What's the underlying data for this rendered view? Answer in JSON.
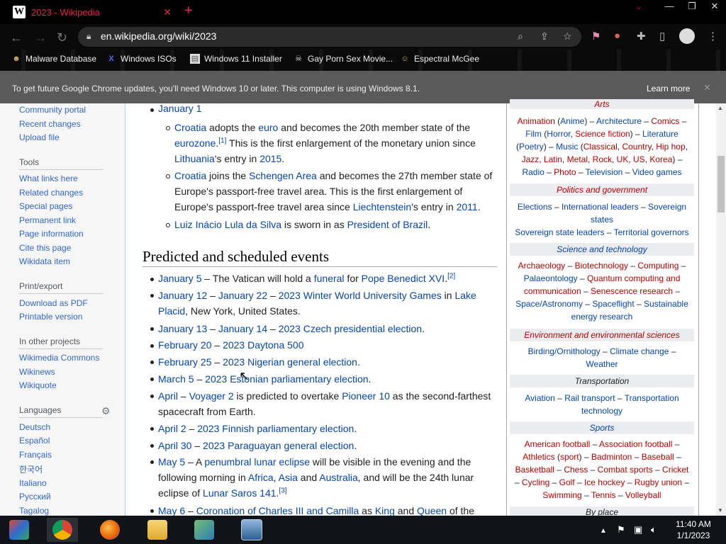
{
  "browser": {
    "tab_title": "2023 - Wikipedia",
    "tab_favicon": "W",
    "tab_close": "✕",
    "new_tab": "+",
    "url": "en.wikipedia.org/wiki/2023",
    "window_controls": {
      "minimize": "—",
      "maximize": "❐",
      "close": "✕"
    },
    "tab_search_icon": "chevron-down-icon"
  },
  "bookmarks": [
    {
      "label": "Malware Database",
      "icon": "person-icon"
    },
    {
      "label": "Windows ISOs",
      "icon": "x-icon"
    },
    {
      "label": "Windows 11 Installer",
      "icon": "doc-icon"
    },
    {
      "label": "Gay Porn Sex Movie...",
      "icon": "skull-icon"
    },
    {
      "label": "Espectral McGee",
      "icon": "face-icon"
    }
  ],
  "infobar": {
    "message": "To get future Google Chrome updates, you'll need Windows 10 or later. This computer is using Windows 8.1.",
    "learn_more": "Learn more",
    "close": "✕"
  },
  "sidebar": {
    "links_top": [
      "Community portal",
      "Recent changes",
      "Upload file"
    ],
    "tools_heading": "Tools",
    "tools": [
      "What links here",
      "Related changes",
      "Special pages",
      "Permanent link",
      "Page information",
      "Cite this page",
      "Wikidata item"
    ],
    "print_heading": "Print/export",
    "print": [
      "Download as PDF",
      "Printable version"
    ],
    "projects_heading": "In other projects",
    "projects": [
      "Wikimedia Commons",
      "Wikinews",
      "Wikiquote"
    ],
    "languages_heading": "Languages",
    "languages": [
      "Deutsch",
      "Español",
      "Français",
      "한국어",
      "Italiano",
      "Русский",
      "Tagalog"
    ]
  },
  "article": {
    "jan1": "January 1",
    "b1": {
      "a1": "Croatia",
      "t1": " adopts the ",
      "a2": "euro",
      "t2": " and becomes the 20th member state of the",
      "a3": "eurozone",
      "t3": ".",
      "ref": "[1]",
      "t4": " This is the first enlargement of the monetary union since",
      "a4": "Lithuania",
      "t5": "'s entry in ",
      "a5": "2015",
      "t6": "."
    },
    "b2": {
      "a1": "Croatia",
      "t1": " joins the ",
      "a2": "Schengen Area",
      "t2": " and becomes the 27th member state of",
      "l2": "Europe's passport-free travel area. This is the first enlargement of",
      "l3a": "Europe's passport-free travel area since ",
      "a3": "Liechtenstein",
      "t3": "'s entry in ",
      "a4": "2011",
      "t4": "."
    },
    "b3": {
      "a1": "Luiz Inácio Lula da Silva",
      "t1": " is sworn in as ",
      "a2": "President of Brazil",
      "t2": "."
    },
    "heading": "Predicted and scheduled events",
    "events": {
      "e1": {
        "a1": "January 5",
        "t1": " – The Vatican will hold a ",
        "a2": "funeral",
        "t2": " for ",
        "a3": "Pope Benedict XVI",
        "t3": ".",
        "ref": "[2]"
      },
      "e2": {
        "a1": "January 12",
        "t1": " – ",
        "a2": "January 22",
        "t2": " – ",
        "a3": "2023 Winter World University Games",
        "t3": " in ",
        "a4": "Lake",
        "a4b": "Placid",
        "t4": ", New York, United States."
      },
      "e3": {
        "a1": "January 13",
        "t1": " – ",
        "a2": "January 14",
        "t2": " – ",
        "a3": "2023 Czech presidential election",
        "t3": "."
      },
      "e4": {
        "a1": "February 20",
        "t1": " – ",
        "a2": "2023 Daytona 500"
      },
      "e5": {
        "a1": "February 25",
        "t1": " – ",
        "a2": "2023 Nigerian general election",
        "t2": "."
      },
      "e6": {
        "a1": "March 5",
        "t1": " – ",
        "a2": "2023 Estonian parliamentary election",
        "t2": "."
      },
      "e7": {
        "a1": "April",
        "t1": " – ",
        "a2": "Voyager 2",
        "t2": " is predicted to overtake ",
        "a3": "Pioneer 10",
        "t3": " as the second-farthest",
        "l2": "spacecraft from Earth."
      },
      "e8": {
        "a1": "April 2",
        "t1": " – ",
        "a2": "2023 Finnish parliamentary election",
        "t2": "."
      },
      "e9": {
        "a1": "April 30",
        "t1": " – ",
        "a2": "2023 Paraguayan general election",
        "t2": "."
      },
      "e10": {
        "a1": "May 5",
        "t1": " – A ",
        "a2": "penumbral lunar eclipse",
        "t2": " will be visible in the evening and the",
        "l2a": "following morning in ",
        "a3": "Africa",
        "t3": ", ",
        "a4": "Asia",
        "t4": " and ",
        "a5": "Australia",
        "t5": ", and will be the 24th lunar",
        "l3a": "eclipse of ",
        "a6": "Lunar Saros 141",
        "t6": ".",
        "ref": "[3]"
      },
      "e11": {
        "a1": "May 6",
        "t1": " – ",
        "a2": "Coronation of Charles III and Camilla",
        "t2": " as ",
        "a3": "King",
        "t3": " and ",
        "a4": "Queen",
        "t4": " of the"
      }
    }
  },
  "navbox": {
    "arts_heading": "Arts",
    "arts_lines": [
      [
        {
          "a": "Animation"
        },
        {
          "t": " ("
        },
        {
          "a": "Anime",
          "b": 1
        },
        {
          "t": ") – "
        },
        {
          "a": "Architecture",
          "b": 1
        },
        {
          "t": " – "
        },
        {
          "a": "Comics"
        },
        {
          "t": " –"
        }
      ],
      [
        {
          "a": "Film",
          "b": 1
        },
        {
          "t": " ("
        },
        {
          "a": "Horror",
          "b": 1
        },
        {
          "t": ", "
        },
        {
          "a": "Science fiction"
        },
        {
          "t": ") – "
        },
        {
          "a": "Literature",
          "b": 1
        }
      ],
      [
        {
          "t": "("
        },
        {
          "a": "Poetry",
          "b": 1
        },
        {
          "t": ") – "
        },
        {
          "a": "Music",
          "b": 1
        },
        {
          "t": " ("
        },
        {
          "a": "Classical"
        },
        {
          "t": ", "
        },
        {
          "a": "Country"
        },
        {
          "t": ", "
        },
        {
          "a": "Hip hop"
        },
        {
          "t": ","
        }
      ],
      [
        {
          "a": "Jazz"
        },
        {
          "t": ", "
        },
        {
          "a": "Latin"
        },
        {
          "t": ", "
        },
        {
          "a": "Metal"
        },
        {
          "t": ", "
        },
        {
          "a": "Rock"
        },
        {
          "t": ", "
        },
        {
          "a": "UK"
        },
        {
          "t": ", "
        },
        {
          "a": "US"
        },
        {
          "t": ", "
        },
        {
          "a": "Korea"
        },
        {
          "t": ") –"
        }
      ],
      [
        {
          "a": "Radio",
          "b": 1
        },
        {
          "t": " – "
        },
        {
          "a": "Photo"
        },
        {
          "t": " – "
        },
        {
          "a": "Television",
          "b": 1
        },
        {
          "t": " – "
        },
        {
          "a": "Video games",
          "b": 1
        }
      ]
    ],
    "politics_heading": "Politics and government",
    "politics_lines": [
      [
        {
          "a": "Elections",
          "b": 1
        },
        {
          "t": " – "
        },
        {
          "a": "International leaders",
          "b": 1
        },
        {
          "t": " – "
        },
        {
          "a": "Sovereign",
          "b": 1
        }
      ],
      [
        {
          "a": "states",
          "b": 1
        }
      ],
      [
        {
          "a": "Sovereign state leaders",
          "b": 1
        },
        {
          "t": " – "
        },
        {
          "a": "Territorial governors",
          "b": 1
        }
      ]
    ],
    "science_heading": "Science and technology",
    "science_lines": [
      [
        {
          "a": "Archaeology"
        },
        {
          "t": " – "
        },
        {
          "a": "Biotechnology"
        },
        {
          "t": " – "
        },
        {
          "a": "Computing"
        },
        {
          "t": " –"
        }
      ],
      [
        {
          "a": "Palaeontology",
          "b": 1
        },
        {
          "t": " – "
        },
        {
          "a": "Quantum computing and"
        }
      ],
      [
        {
          "a": "communication"
        },
        {
          "t": " – "
        },
        {
          "a": "Senescence research"
        },
        {
          "t": " –"
        }
      ],
      [
        {
          "a": "Space/Astronomy",
          "b": 1
        },
        {
          "t": " – "
        },
        {
          "a": "Spaceflight",
          "b": 1
        },
        {
          "t": " – "
        },
        {
          "a": "Sustainable",
          "b": 1
        }
      ],
      [
        {
          "a": "energy research",
          "b": 1
        }
      ]
    ],
    "env_heading": "Environment and environmental sciences",
    "env_lines": [
      [
        {
          "a": "Birding/Ornithology",
          "b": 1
        },
        {
          "t": " – "
        },
        {
          "a": "Climate change",
          "b": 1
        },
        {
          "t": " –"
        }
      ],
      [
        {
          "a": "Weather",
          "b": 1
        }
      ]
    ],
    "transport_heading": "Transportation",
    "transport_lines": [
      [
        {
          "a": "Aviation",
          "b": 1
        },
        {
          "t": " – "
        },
        {
          "a": "Rail transport",
          "b": 1
        },
        {
          "t": " – "
        },
        {
          "a": "Transportation",
          "b": 1
        }
      ],
      [
        {
          "a": "technology",
          "b": 1
        }
      ]
    ],
    "sports_heading": "Sports",
    "sports_lines": [
      [
        {
          "a": "American football"
        },
        {
          "t": " – "
        },
        {
          "a": "Association football"
        },
        {
          "t": " –"
        }
      ],
      [
        {
          "a": "Athletics"
        },
        {
          "t": " ("
        },
        {
          "a": "sport"
        },
        {
          "t": ") – "
        },
        {
          "a": "Badminton"
        },
        {
          "t": " – "
        },
        {
          "a": "Baseball"
        },
        {
          "t": " –"
        }
      ],
      [
        {
          "a": "Basketball"
        },
        {
          "t": " – "
        },
        {
          "a": "Chess"
        },
        {
          "t": " – "
        },
        {
          "a": "Combat sports"
        },
        {
          "t": " – "
        },
        {
          "a": "Cricket"
        }
      ],
      [
        {
          "t": "– "
        },
        {
          "a": "Cycling"
        },
        {
          "t": " – "
        },
        {
          "a": "Golf"
        },
        {
          "t": " – "
        },
        {
          "a": "Ice hockey"
        },
        {
          "t": " – "
        },
        {
          "a": "Rugby union"
        },
        {
          "t": " –"
        }
      ],
      [
        {
          "a": "Swimming"
        },
        {
          "t": " – "
        },
        {
          "a": "Tennis"
        },
        {
          "t": " – "
        },
        {
          "a": "Volleyball"
        }
      ]
    ],
    "byplace_heading": "By place"
  },
  "taskbar": {
    "time": "11:40 AM",
    "date": "1/1/2023",
    "apps": [
      {
        "name": "media-app-icon",
        "color": "#2b6cd4"
      },
      {
        "name": "chrome-icon",
        "color": "#e4b429"
      },
      {
        "name": "firefox-icon",
        "color": "#e66000"
      },
      {
        "name": "file-explorer-icon",
        "color": "#f0c24b"
      },
      {
        "name": "network-app-icon",
        "color": "#3aa35c"
      },
      {
        "name": "photos-app-icon",
        "color": "#4a7fb5"
      }
    ]
  },
  "colors": {
    "link": "#0645ad",
    "redlink": "#ba0000",
    "tab_red": "#e8234a"
  }
}
